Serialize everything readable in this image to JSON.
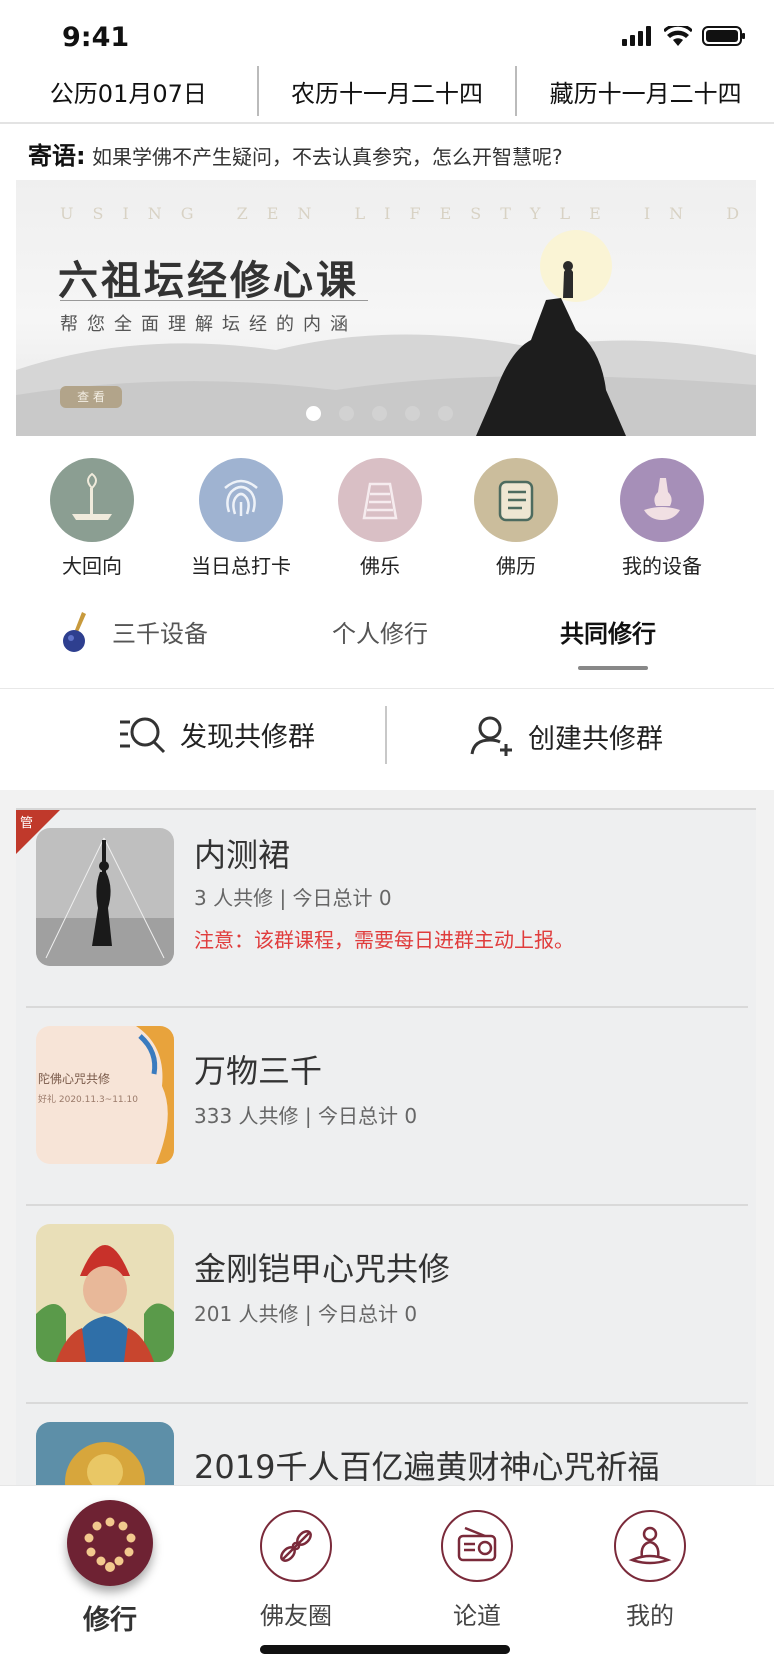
{
  "status_bar": {
    "time": "9:41"
  },
  "dates": {
    "gregorian": "公历01月07日",
    "lunar": "农历十一月二十四",
    "tibetan": "藏历十一月二十四"
  },
  "motto": {
    "label": "寄语:",
    "text": "如果学佛不产生疑问，不去认真参究，怎么开智慧呢?"
  },
  "banner": {
    "english_line": "USING ZEN LIFESTYLE IN DAILY LIFE",
    "title": "六祖坛经修心课",
    "subtitle": "帮您全面理解坛经的内涵",
    "button_label": "查 看",
    "slide_count": 5,
    "active_slide": 0
  },
  "shortcuts": [
    {
      "label": "大回向",
      "icon": "incense-icon",
      "color": "#8b9e92"
    },
    {
      "label": "当日总打卡",
      "icon": "fingerprint-icon",
      "color": "#9fb3d1"
    },
    {
      "label": "佛乐",
      "icon": "music-player-icon",
      "color": "#d9bfc5"
    },
    {
      "label": "佛历",
      "icon": "calendar-list-icon",
      "color": "#cbbd9c"
    },
    {
      "label": "我的设备",
      "icon": "vase-hand-icon",
      "color": "#a68fb8"
    }
  ],
  "tabs": [
    {
      "label": "三千设备",
      "active": false
    },
    {
      "label": "个人修行",
      "active": false
    },
    {
      "label": "共同修行",
      "active": true
    }
  ],
  "actions": {
    "discover": "发现共修群",
    "create": "创建共修群"
  },
  "groups": [
    {
      "name": "内测裙",
      "stats": "3 人共修 | 今日总计 0",
      "notice": "注意：该群课程，需要每日进群主动上报。",
      "admin": true,
      "admin_label": "管"
    },
    {
      "name": "万物三千",
      "stats": "333 人共修 | 今日总计 0",
      "thumb_text_1": "陀佛心咒共修",
      "thumb_text_2": "好礼  2020.11.3~11.10"
    },
    {
      "name": "金刚铠甲心咒共修",
      "stats": "201 人共修 | 今日总计 0"
    },
    {
      "name": "2019千人百亿遍黄财神心咒祈福"
    }
  ],
  "bottom_nav": [
    {
      "label": "修行",
      "icon": "prayer-beads-icon",
      "active": true
    },
    {
      "label": "佛友圈",
      "icon": "vajra-icon",
      "active": false
    },
    {
      "label": "论道",
      "icon": "radio-icon",
      "active": false
    },
    {
      "label": "我的",
      "icon": "meditating-figure-icon",
      "active": false
    }
  ],
  "colors": {
    "brand": "#6e2233",
    "notice": "#e03c3c"
  }
}
